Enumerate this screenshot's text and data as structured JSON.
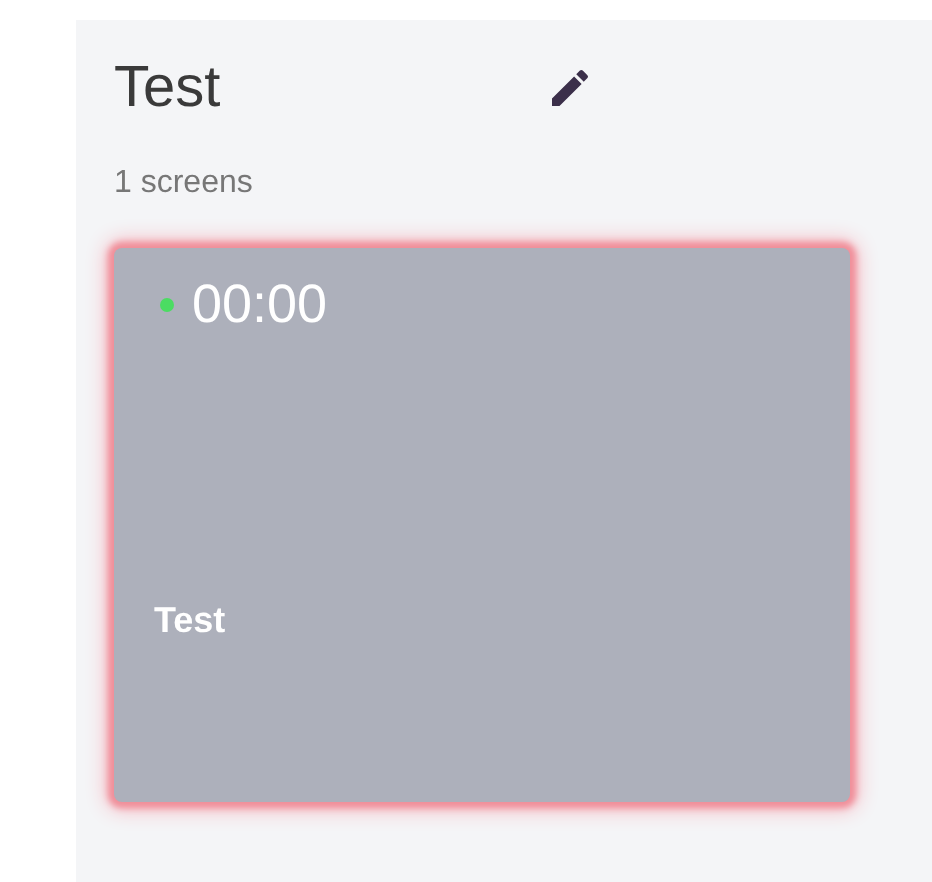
{
  "group": {
    "title": "Test",
    "count_label": "1 screens"
  },
  "screens": [
    {
      "name": "Test",
      "time": "00:00",
      "live": true,
      "selected": true
    }
  ]
}
